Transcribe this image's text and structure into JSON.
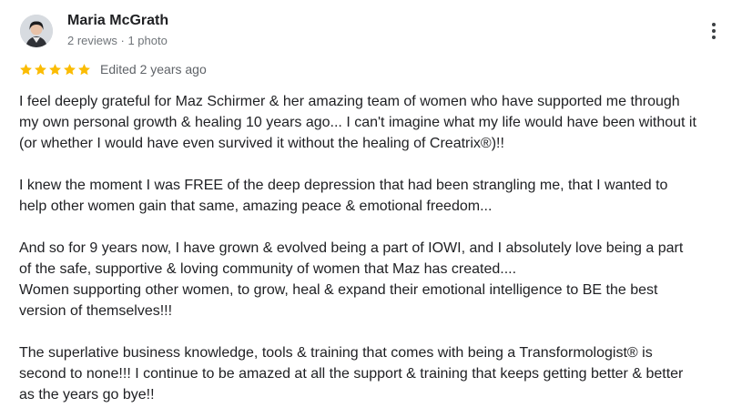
{
  "review": {
    "author": "Maria McGrath",
    "meta": "2 reviews · 1 photo",
    "rating": 5,
    "rating_max": 5,
    "edited": "Edited 2 years ago",
    "star_color": "#fbbc04",
    "paragraphs": [
      [
        "I feel deeply grateful for Maz Schirmer & her amazing team of women who have supported me through",
        "my own personal growth & healing 10 years ago... I can't imagine what my life would have been without it",
        "(or whether I would have even survived it without the healing of Creatrix®)!!"
      ],
      [
        "I knew the moment I was FREE of the deep depression that had been strangling me, that I wanted to",
        "help other women gain that same, amazing peace & emotional freedom..."
      ],
      [
        "And so for 9 years now, I have grown & evolved being a part of IOWI, and I absolutely love being a part",
        "of the safe, supportive & loving community of women that Maz has created....",
        "Women supporting other women, to grow, heal & expand their emotional intelligence to BE the best",
        "version of themselves!!!"
      ],
      [
        "The superlative business knowledge, tools & training that comes with being a Transformologist® is",
        "second to none!!! I continue to be amazed at all the support & training that keeps getting better & better",
        "as the years go bye!!"
      ]
    ]
  },
  "icons": {
    "avatar": "user-avatar-photo",
    "more": "more-vert-icon",
    "star": "star-icon"
  }
}
